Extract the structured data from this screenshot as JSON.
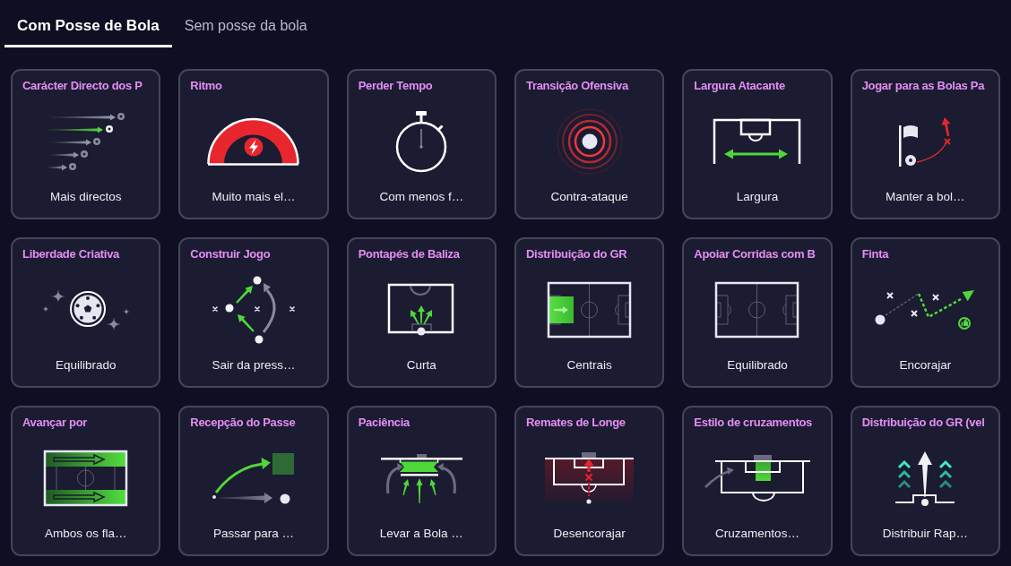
{
  "tabs": [
    {
      "label": "Com Posse de Bola",
      "selected": true
    },
    {
      "label": "Sem posse da bola",
      "selected": false
    }
  ],
  "cards": [
    {
      "title": "Carácter Directo dos P",
      "kind": "arrows",
      "value": "Mais directos"
    },
    {
      "title": "Ritmo",
      "kind": "gauge",
      "value": "Muito mais el…"
    },
    {
      "title": "Perder Tempo",
      "kind": "stopwatch",
      "value": "Com menos f…"
    },
    {
      "title": "Transição Ofensiva",
      "kind": "rings",
      "value": "Contra-ataque"
    },
    {
      "title": "Largura Atacante",
      "kind": "width",
      "value": "Largura"
    },
    {
      "title": "Jogar para as Bolas Pa",
      "kind": "corner",
      "value": "Manter a bol…"
    },
    {
      "title": "Liberdade Criativa",
      "kind": "sparkle",
      "value": "Equilibrado"
    },
    {
      "title": "Construir Jogo",
      "kind": "buildup",
      "value": "Sair da press…"
    },
    {
      "title": "Pontapés de Baliza",
      "kind": "goalkick",
      "value": "Curta"
    },
    {
      "title": "Distribuição do GR",
      "kind": "keeper",
      "value": "Centrais"
    },
    {
      "title": "Apoiar Corridas com B",
      "kind": "pitch",
      "value": "Equilibrado"
    },
    {
      "title": "Finta",
      "kind": "dribble",
      "value": "Encorajar"
    },
    {
      "title": "Avançar por",
      "kind": "flanks",
      "value": "Ambos os fla…"
    },
    {
      "title": "Recepção do Passe",
      "kind": "reception",
      "value": "Passar para …"
    },
    {
      "title": "Paciência",
      "kind": "patience",
      "value": "Levar a Bola …"
    },
    {
      "title": "Remates de Longe",
      "kind": "shots",
      "value": "Desencorajar"
    },
    {
      "title": "Estilo de cruzamentos",
      "kind": "crosses",
      "value": "Cruzamentos…"
    },
    {
      "title": "Distribuição do GR (vel",
      "kind": "launch",
      "value": "Distribuir Rap…"
    }
  ]
}
